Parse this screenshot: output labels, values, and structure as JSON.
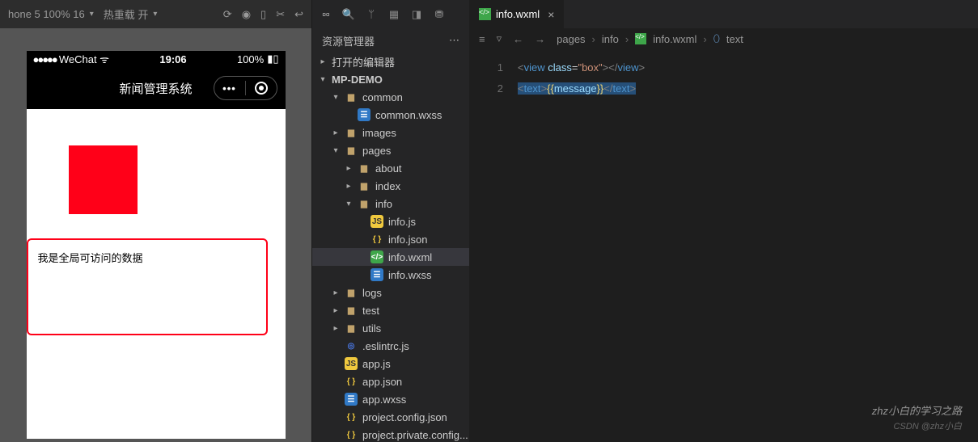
{
  "toolbar": {
    "device": "hone 5 100% 16",
    "hot_reload": "热重载 开"
  },
  "phone": {
    "carrier": "WeChat",
    "time": "19:06",
    "battery": "100%",
    "title": "新闻管理系统",
    "message": "我是全局可访问的数据"
  },
  "explorer": {
    "title": "资源管理器",
    "sections": {
      "open_editors": "打开的编辑器",
      "project": "MP-DEMO"
    },
    "tree": [
      {
        "label": "common",
        "depth": 1,
        "open": true,
        "type": "folder"
      },
      {
        "label": "common.wxss",
        "depth": 2,
        "type": "wxss"
      },
      {
        "label": "images",
        "depth": 1,
        "type": "img",
        "folder": true
      },
      {
        "label": "pages",
        "depth": 1,
        "open": true,
        "type": "folder"
      },
      {
        "label": "about",
        "depth": 2,
        "type": "folder"
      },
      {
        "label": "index",
        "depth": 2,
        "type": "folder"
      },
      {
        "label": "info",
        "depth": 2,
        "open": true,
        "type": "folder"
      },
      {
        "label": "info.js",
        "depth": 3,
        "type": "js"
      },
      {
        "label": "info.json",
        "depth": 3,
        "type": "json"
      },
      {
        "label": "info.wxml",
        "depth": 3,
        "type": "wxml",
        "selected": true
      },
      {
        "label": "info.wxss",
        "depth": 3,
        "type": "wxss"
      },
      {
        "label": "logs",
        "depth": 1,
        "type": "folder"
      },
      {
        "label": "test",
        "depth": 1,
        "type": "folder"
      },
      {
        "label": "utils",
        "depth": 1,
        "type": "folder"
      },
      {
        "label": ".eslintrc.js",
        "depth": 1,
        "type": "eslint"
      },
      {
        "label": "app.js",
        "depth": 1,
        "type": "js"
      },
      {
        "label": "app.json",
        "depth": 1,
        "type": "json"
      },
      {
        "label": "app.wxss",
        "depth": 1,
        "type": "wxss"
      },
      {
        "label": "project.config.json",
        "depth": 1,
        "type": "json"
      },
      {
        "label": "project.private.config...",
        "depth": 1,
        "type": "json"
      }
    ]
  },
  "editor": {
    "tab": "info.wxml",
    "breadcrumbs": [
      "pages",
      "info",
      "info.wxml",
      "text"
    ],
    "code": {
      "line1": {
        "tag_open": "<",
        "tag": "view",
        "attr": "class",
        "eq": "=",
        "str": "\"box\"",
        "close": "></",
        "tag2": "view",
        "end": ">"
      },
      "line2": {
        "tag_open": "<",
        "tag": "text",
        "close1": ">",
        "curl_o": "{{",
        "var": "message",
        "curl_c": "}}",
        "close2": "</",
        "tag2": "text",
        "end": ">"
      }
    }
  },
  "watermark": {
    "main": "zhz小白的学习之路",
    "sub": "CSDN @zhz小白"
  }
}
